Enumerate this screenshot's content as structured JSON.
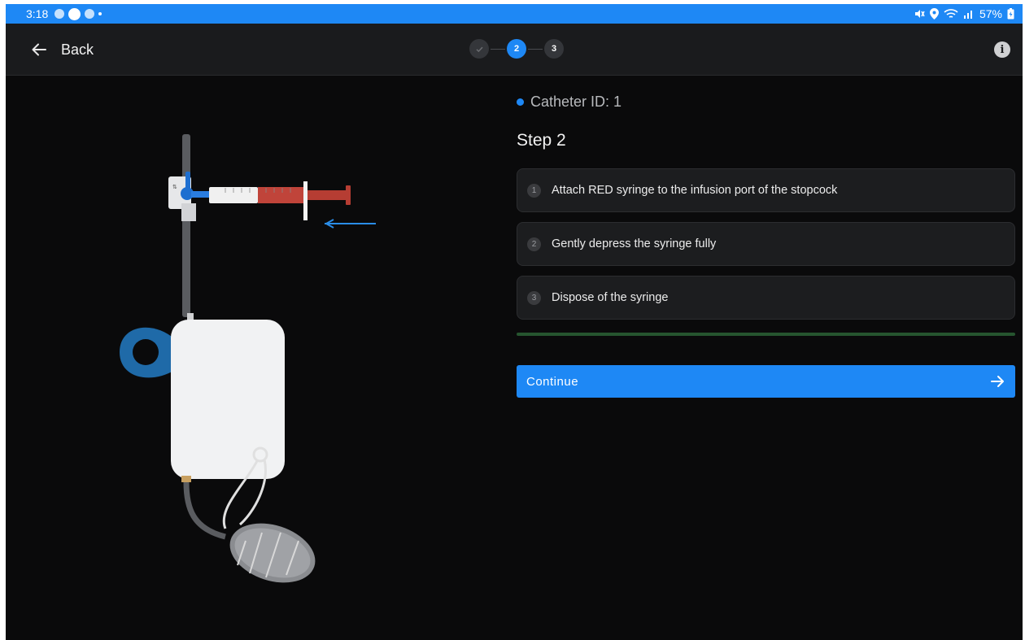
{
  "status_bar": {
    "time": "3:18",
    "battery": "57%"
  },
  "app_bar": {
    "back_label": "Back",
    "steps": [
      {
        "state": "done",
        "label": ""
      },
      {
        "state": "active",
        "label": "2"
      },
      {
        "state": "todo",
        "label": "3"
      }
    ],
    "info_icon": "i"
  },
  "main": {
    "catheter_id": "Catheter ID: 1",
    "step_title": "Step 2",
    "instructions": [
      {
        "num": "1",
        "text": "Attach RED syringe to the infusion port of the stopcock"
      },
      {
        "num": "2",
        "text": "Gently depress the syringe fully"
      },
      {
        "num": "3",
        "text": "Dispose of the syringe"
      }
    ],
    "progress": 1.0,
    "continue_label": "Continue"
  },
  "colors": {
    "accent": "#1e88f5",
    "background": "#0a0a0b",
    "card": "#1c1d1f",
    "progress": "#26552f",
    "syringe_red": "#c0443a"
  },
  "icons": {
    "back": "arrow-left-icon",
    "info": "info-icon",
    "continue": "arrow-right-icon",
    "step_done": "check-icon"
  }
}
